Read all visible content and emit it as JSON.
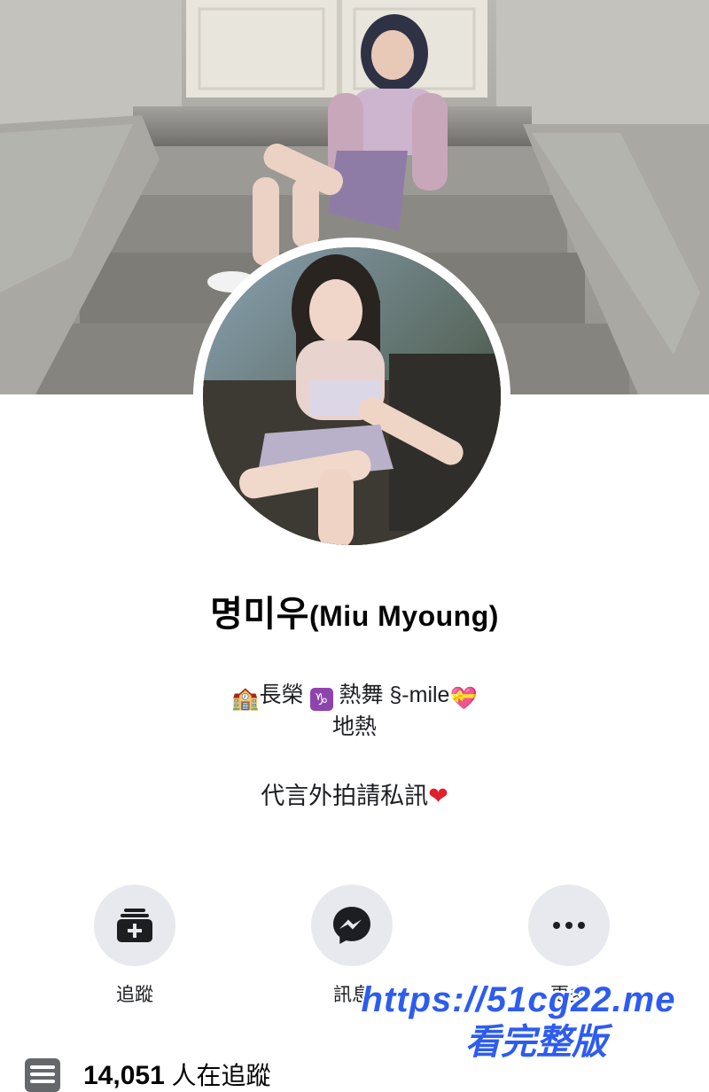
{
  "profile": {
    "name_main": "명미우",
    "name_latin": "(Miu Myoung)"
  },
  "bio": {
    "line1_a": "長榮",
    "line1_b": "熱舞 §-mile",
    "line2": "地熱",
    "line3": "代言外拍請私訊",
    "emoji_school": "🏫",
    "emoji_capricorn": "♑",
    "emoji_heart_gift": "💝",
    "emoji_heart": "❤"
  },
  "actions": [
    {
      "label": "追蹤",
      "icon": "add-page-icon"
    },
    {
      "label": "訊息",
      "icon": "messenger-icon"
    },
    {
      "label": "更多",
      "icon": "more-icon"
    }
  ],
  "followers": {
    "count": "14,051",
    "suffix": " 人在追蹤"
  },
  "watermark": {
    "url": "https://51cg22.me",
    "caption": "看完整版"
  },
  "colors": {
    "action_bg": "#e8e9ee",
    "watermark": "#2d5cf0",
    "heart": "#e0202c"
  }
}
